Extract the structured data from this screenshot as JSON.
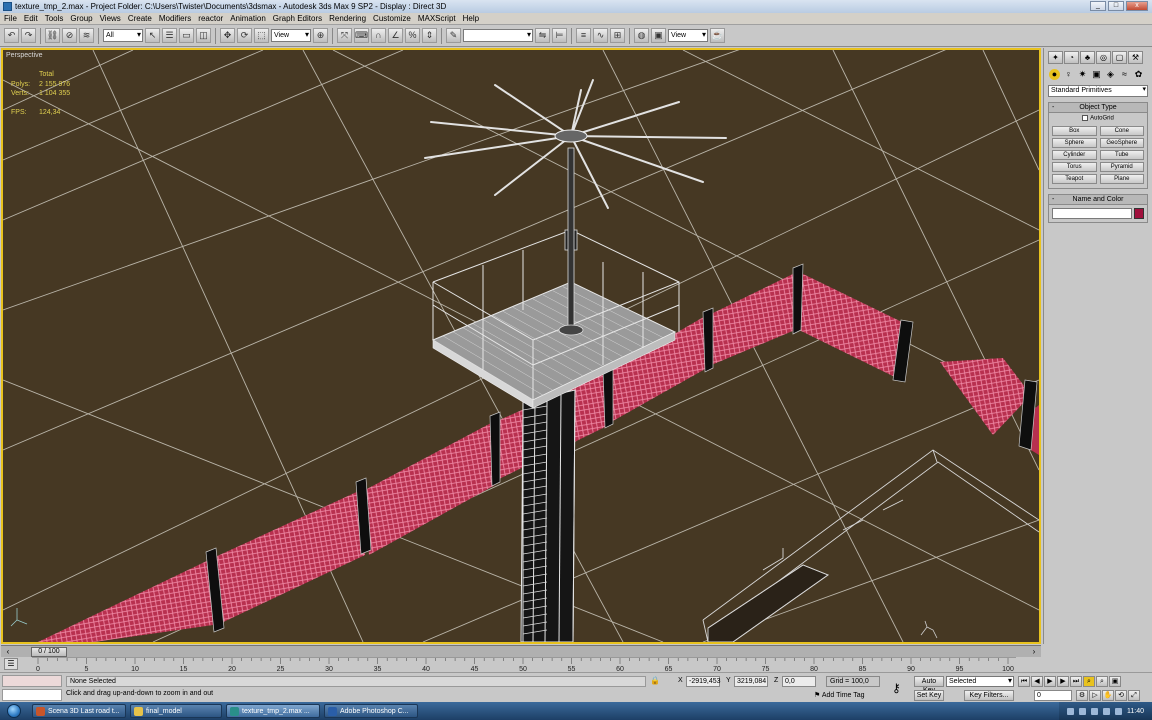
{
  "titlebar": {
    "title": "texture_tmp_2.max    - Project Folder: C:\\Users\\Twister\\Documents\\3dsmax    - Autodesk 3ds Max 9 SP2    - Display : Direct 3D",
    "minimize": "_",
    "maximize": "□",
    "close": "x"
  },
  "menu": [
    "File",
    "Edit",
    "Tools",
    "Group",
    "Views",
    "Create",
    "Modifiers",
    "reactor",
    "Animation",
    "Graph Editors",
    "Rendering",
    "Customize",
    "MAXScript",
    "Help"
  ],
  "toolbar": {
    "selection_filter": "All",
    "reference_coord": "View",
    "named_selection": "",
    "pivot_view": "View"
  },
  "viewport": {
    "label": "Perspective",
    "stats": {
      "header": "Total",
      "polys_label": "Polys:",
      "polys_value": "2 155 976",
      "verts_label": "Verts:",
      "verts_value": "1 104 355",
      "fps_label": "FPS:",
      "fps_value": "124,34"
    },
    "colors": {
      "background": "#463823",
      "grid": "#b9b4a8",
      "fence": "#d9577a",
      "active_border": "#e8c21e"
    }
  },
  "command_panel": {
    "category": "Standard Primitives",
    "object_type_title": "Object Type",
    "autogrid": "AutoGrid",
    "primitives": [
      "Box",
      "Cone",
      "Sphere",
      "GeoSphere",
      "Cylinder",
      "Tube",
      "Torus",
      "Pyramid",
      "Teapot",
      "Plane"
    ],
    "name_color_title": "Name and Color",
    "swatch_color": "#a0103c"
  },
  "timeline": {
    "frame_display": "0 / 100",
    "ticks": [
      "0",
      "5",
      "10",
      "15",
      "20",
      "25",
      "30",
      "35",
      "40",
      "45",
      "50",
      "55",
      "60",
      "65",
      "70",
      "75",
      "80",
      "85",
      "90",
      "95",
      "100"
    ]
  },
  "status": {
    "selection": "None Selected",
    "prompt": "Click and drag up-and-down to zoom in and out",
    "x_label": "X",
    "x_value": "-2919,453",
    "y_label": "Y",
    "y_value": "3219,084",
    "z_label": "Z",
    "z_value": "0,0",
    "grid": "Grid = 100,0",
    "time_tag": "Add Time Tag",
    "auto_key": "Auto Key",
    "auto_key_mode": "Selected",
    "set_key": "Set Key",
    "key_filters": "Key Filters...",
    "current_frame": "0"
  },
  "taskbar": {
    "items": [
      {
        "label": "Scena 3D Last road t...",
        "color": "#c8552a"
      },
      {
        "label": "final_model",
        "color": "#e6c24a"
      },
      {
        "label": "texture_tmp_2.max ...",
        "color": "#2a8f8a"
      },
      {
        "label": "Adobe Photoshop C...",
        "color": "#2a5ea8"
      }
    ],
    "clock": "11:40"
  }
}
